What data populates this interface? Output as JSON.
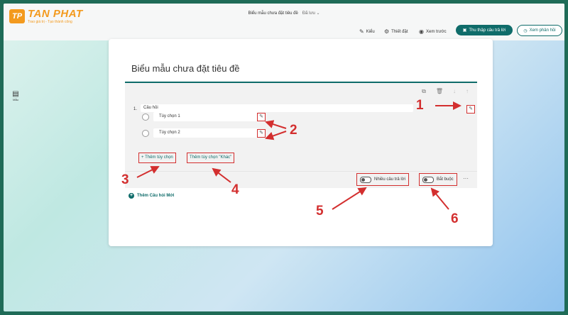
{
  "brand": {
    "mark": "TP",
    "name": "TAN PHAT",
    "tagline": "Trao giá trị - Tạo thành công"
  },
  "header": {
    "doc_title": "Biểu mẫu chưa đặt tiêu đề",
    "saved": "Đã lưu ⌄"
  },
  "toolbar": {
    "style": "Kiểu",
    "settings": "Thiết đặt",
    "preview": "Xem trước",
    "collect": "Thu thập câu trả lời",
    "responses": "Xem phản hồi"
  },
  "sidebar": {
    "label": "Mẫu"
  },
  "form": {
    "title": "Biểu mẫu chưa đặt tiêu đề",
    "question_number": "1.",
    "question_placeholder": "Câu hỏi",
    "options": [
      "Tùy chọn 1",
      "Tùy chọn 2"
    ],
    "add_option": "+ Thêm tùy chọn",
    "add_other": "Thêm tùy chọn \"Khác\"",
    "multi_answer": "Nhiều câu trả lời",
    "required": "Bắt buộc",
    "add_question": "Thêm Câu hỏi Mới"
  },
  "annotations": [
    "1",
    "2",
    "3",
    "4",
    "5",
    "6"
  ],
  "colors": {
    "accent": "#0f6c6a",
    "annotation": "#d32f2f",
    "brand": "#f39a1e"
  }
}
